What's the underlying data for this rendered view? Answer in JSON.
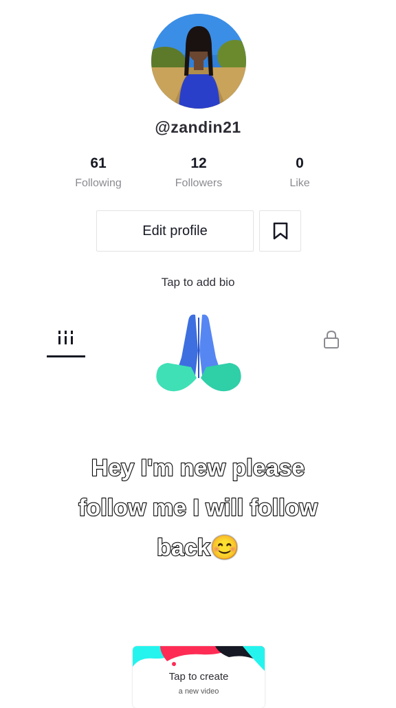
{
  "profile": {
    "username": "@zandin21",
    "stats": [
      {
        "value": "61",
        "label": "Following"
      },
      {
        "value": "12",
        "label": "Followers"
      },
      {
        "value": "0",
        "label": "Like"
      }
    ],
    "edit_label": "Edit profile",
    "bio_prompt": "Tap to add bio"
  },
  "tabs": {
    "videos_icon": "grid-icon",
    "private_icon": "lock-icon"
  },
  "overlay": {
    "sticker": "praying-hands",
    "caption_lines": [
      "Hey I'm  new please",
      "follow me I will follow",
      "back"
    ],
    "caption_emoji": "😊"
  },
  "create_card": {
    "title": "Tap to create",
    "subtitle": "a new video"
  },
  "colors": {
    "accent_red": "#fe2c55",
    "accent_cyan": "#25f4ee",
    "text": "#161823",
    "muted": "#8a8b91"
  }
}
